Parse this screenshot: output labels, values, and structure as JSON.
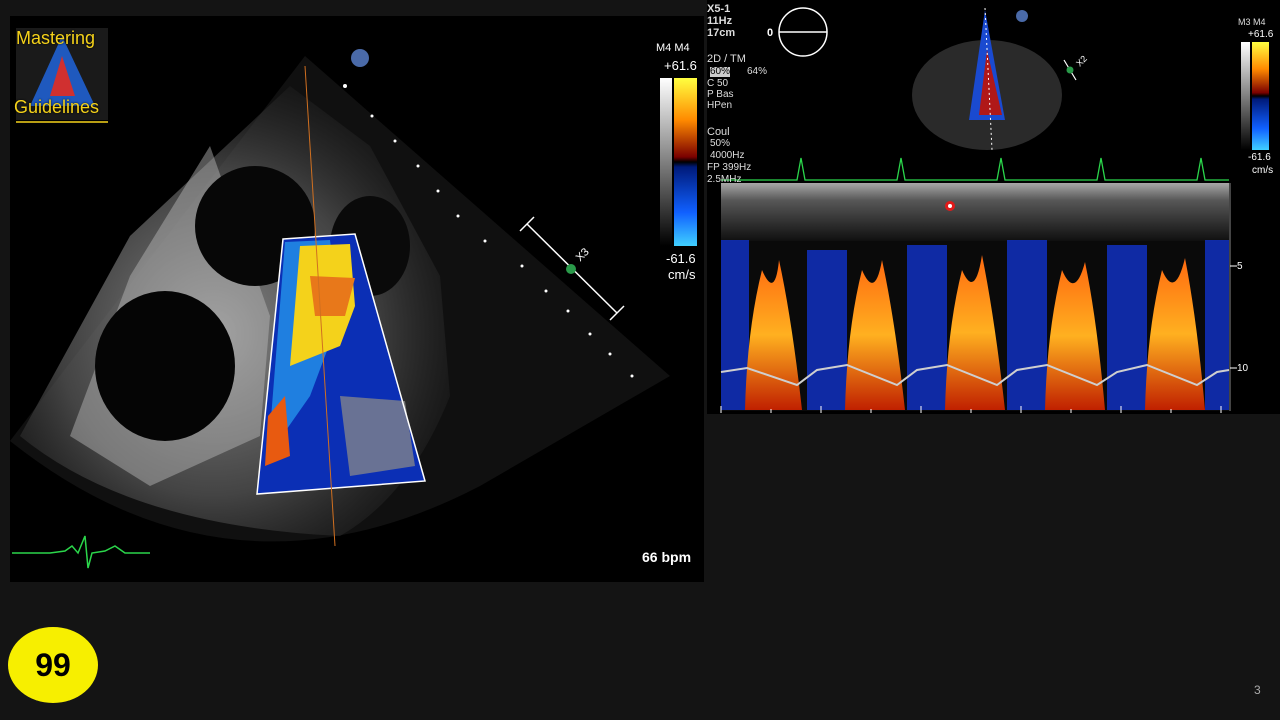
{
  "left_view": {
    "logo_line1": "Mastering",
    "logo_line2": "Guidelines",
    "scale_header": "M4   M4",
    "scale_max": "+61.6",
    "scale_min": "-61.6",
    "scale_unit": "cm/s",
    "probe_marker": "X3",
    "heart_rate": "66 bpm"
  },
  "right_view": {
    "probe": "X5-1",
    "frame_rate": "11Hz",
    "depth": "17cm",
    "angle_zero": "0",
    "mode_2d": "2D / TM",
    "gain_2d": "60%",
    "gain_2d_b": "64%",
    "compression": "C 50",
    "persistence": "P Bas",
    "harmonic": "HPen",
    "color_label": "Coul",
    "color_gain": "50%",
    "prf": "4000Hz",
    "filter": "FP 399Hz",
    "freq": "2.5MHz",
    "scale_header": "M3 M4",
    "scale_max": "+61.6",
    "scale_min": "-61.6",
    "scale_unit": "cm/s",
    "depth_tick_5": "5",
    "depth_tick_10": "10",
    "probe_marker": "X2"
  },
  "slide": {
    "badge": "99",
    "page_number": "3"
  }
}
